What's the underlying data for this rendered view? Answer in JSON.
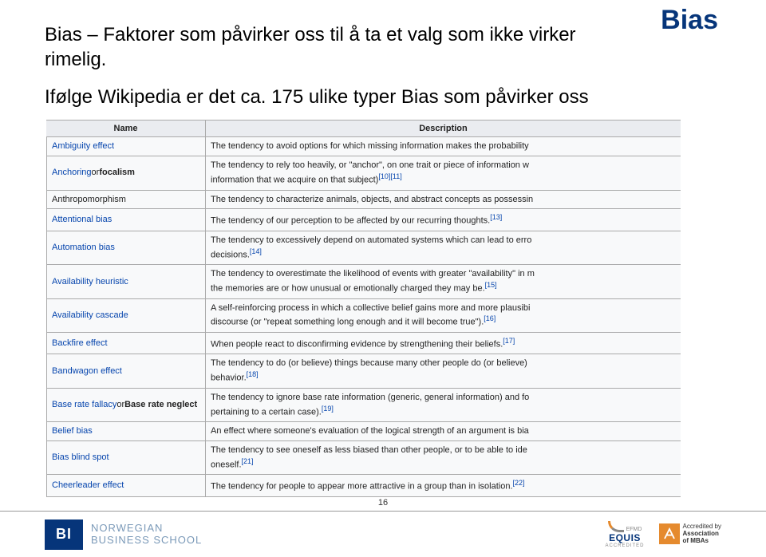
{
  "title_right": "Bias",
  "heading_line1": "Bias – Faktorer som påvirker oss til å ta et valg som ikke virker",
  "heading_line2": "rimelig.",
  "subheading": "Ifølge Wikipedia er det ca. 175 ulike typer Bias som påvirker oss",
  "table": {
    "header_name": "Name",
    "header_desc": "Description",
    "rows": [
      {
        "name_parts": [
          {
            "t": "Ambiguity effect",
            "cls": "link"
          }
        ],
        "desc": "The tendency to avoid options for which missing information makes the probability",
        "refs": []
      },
      {
        "name_parts": [
          {
            "t": "Anchoring",
            "cls": "link"
          },
          {
            "t": " or ",
            "cls": "plain"
          },
          {
            "t": "focalism",
            "cls": "bold"
          }
        ],
        "desc": "The tendency to rely too heavily, or \"anchor\", on one trait or piece of information w",
        "desc2": "information that we acquire on that subject)",
        "refs": [
          "[10]",
          "[11]"
        ]
      },
      {
        "name_parts": [
          {
            "t": "Anthropomorphism",
            "cls": "plain"
          }
        ],
        "desc": "The tendency to characterize animals, objects, and abstract concepts as possessin",
        "refs": []
      },
      {
        "name_parts": [
          {
            "t": "Attentional bias",
            "cls": "link"
          }
        ],
        "desc": "The tendency of our perception to be affected by our recurring thoughts.",
        "refs": [
          "[13]"
        ]
      },
      {
        "name_parts": [
          {
            "t": "Automation bias",
            "cls": "link"
          }
        ],
        "desc": "The tendency to excessively depend on automated systems which can lead to erro",
        "desc2": "decisions.",
        "refs": [
          "[14]"
        ]
      },
      {
        "name_parts": [
          {
            "t": "Availability heuristic",
            "cls": "link"
          }
        ],
        "desc": "The tendency to overestimate the likelihood of events with greater \"availability\" in m",
        "desc2": "the memories are or how unusual or emotionally charged they may be.",
        "refs": [
          "[15]"
        ]
      },
      {
        "name_parts": [
          {
            "t": "Availability cascade",
            "cls": "link"
          }
        ],
        "desc": "A self-reinforcing process in which a collective belief gains more and more plausibi",
        "desc2": "discourse (or \"repeat something long enough and it will become true\").",
        "refs": [
          "[16]"
        ]
      },
      {
        "name_parts": [
          {
            "t": "Backfire effect",
            "cls": "link"
          }
        ],
        "desc": "When people react to disconfirming evidence by strengthening their beliefs.",
        "refs": [
          "[17]"
        ]
      },
      {
        "name_parts": [
          {
            "t": "Bandwagon effect",
            "cls": "link"
          }
        ],
        "desc": "The tendency to do (or believe) things because many other people do (or believe)",
        "desc2": "behavior.",
        "refs": [
          "[18]"
        ]
      },
      {
        "name_parts": [
          {
            "t": "Base rate fallacy",
            "cls": "link"
          },
          {
            "t": " or ",
            "cls": "plain"
          },
          {
            "t": "Base rate neglect",
            "cls": "bold"
          }
        ],
        "desc": "The tendency to ignore base rate information (generic, general information) and fo",
        "desc2": "pertaining to a certain case).",
        "refs": [
          "[19]"
        ]
      },
      {
        "name_parts": [
          {
            "t": "Belief bias",
            "cls": "link"
          }
        ],
        "desc": "An effect where someone's evaluation of the logical strength of an argument is bia",
        "refs": []
      },
      {
        "name_parts": [
          {
            "t": "Bias blind spot",
            "cls": "link"
          }
        ],
        "desc": "The tendency to see oneself as less biased than other people, or to be able to ide",
        "desc2": "oneself.",
        "refs": [
          "[21]"
        ]
      },
      {
        "name_parts": [
          {
            "t": "Cheerleader effect",
            "cls": "link"
          }
        ],
        "desc": "The tendency for people to appear more attractive in a group than in isolation.",
        "refs": [
          "[22]"
        ]
      }
    ]
  },
  "page_number": "16",
  "footer": {
    "bi_mark": "BI",
    "bi_line1": "NORWEGIAN",
    "bi_line2": "BUSINESS SCHOOL",
    "efmd": "EFMD",
    "equis": "EQUIS",
    "equis_acc": "ACCREDITED",
    "amba_l1": "Accredited by",
    "amba_l2": "Association",
    "amba_l3": "of MBAs"
  }
}
